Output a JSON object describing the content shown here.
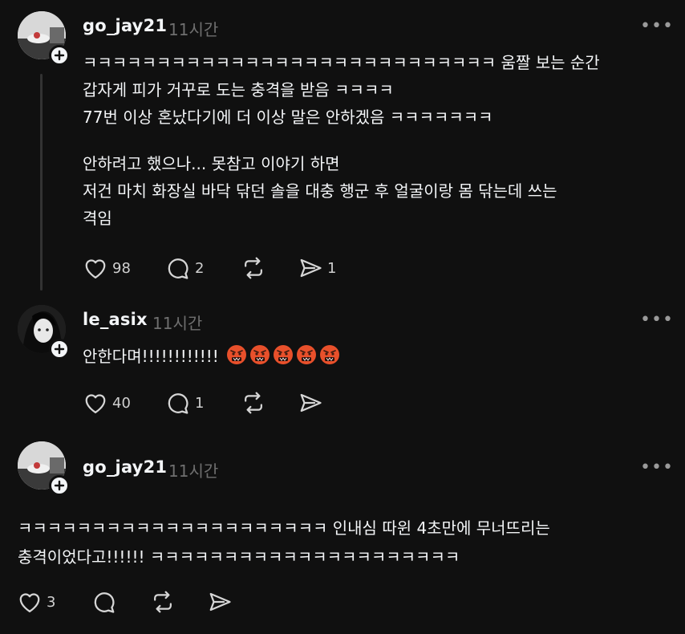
{
  "posts": [
    {
      "username": "go_jay21",
      "time": "11시간",
      "lines": [
        "ㅋㅋㅋㅋㅋㅋㅋㅋㅋㅋㅋㅋㅋㅋㅋㅋㅋㅋㅋㅋㅋㅋㅋㅋㅋㅋㅋㅋ 움짤 보는 순간",
        "갑자게 피가 거꾸로 도는 충격을 받음 ㅋㅋㅋㅋ",
        "77번 이상 혼났다기에 더 이상 말은 안하겠음 ㅋㅋㅋㅋㅋㅋㅋ",
        "안하려고 했으나... 못참고 이야기 하면",
        "저건 마치 화장실 바닥 닦던 솔을 대충 행군 후 얼굴이랑 몸 닦는데 쓰는",
        "격임"
      ],
      "likes": "98",
      "comments": "2",
      "reposts": "",
      "shares": "1"
    },
    {
      "username": "le_asix",
      "time": "11시간",
      "text": "안한다며!!!!!!!!!!!!",
      "emoji_count": 5,
      "likes": "40",
      "comments": "1",
      "reposts": "",
      "shares": ""
    },
    {
      "username": "go_jay21",
      "time": "11시간",
      "lines": [
        "ㅋㅋㅋㅋㅋㅋㅋㅋㅋㅋㅋㅋㅋㅋㅋㅋㅋㅋㅋㅋㅋ 인내심 따윈 4초만에 무너뜨리는",
        "충격이었다고!!!!!! ㅋㅋㅋㅋㅋㅋㅋㅋㅋㅋㅋㅋㅋㅋㅋㅋㅋㅋㅋㅋㅋ"
      ],
      "likes": "3",
      "comments": "",
      "reposts": "",
      "shares": ""
    }
  ],
  "icons": {
    "like": "heart-icon",
    "comment": "comment-icon",
    "repost": "repost-icon",
    "share": "share-icon",
    "more": "more-icon",
    "follow": "plus-icon"
  },
  "colors": {
    "background": "#101010",
    "text": "#f3f5f7",
    "muted": "#6f6f6f"
  }
}
